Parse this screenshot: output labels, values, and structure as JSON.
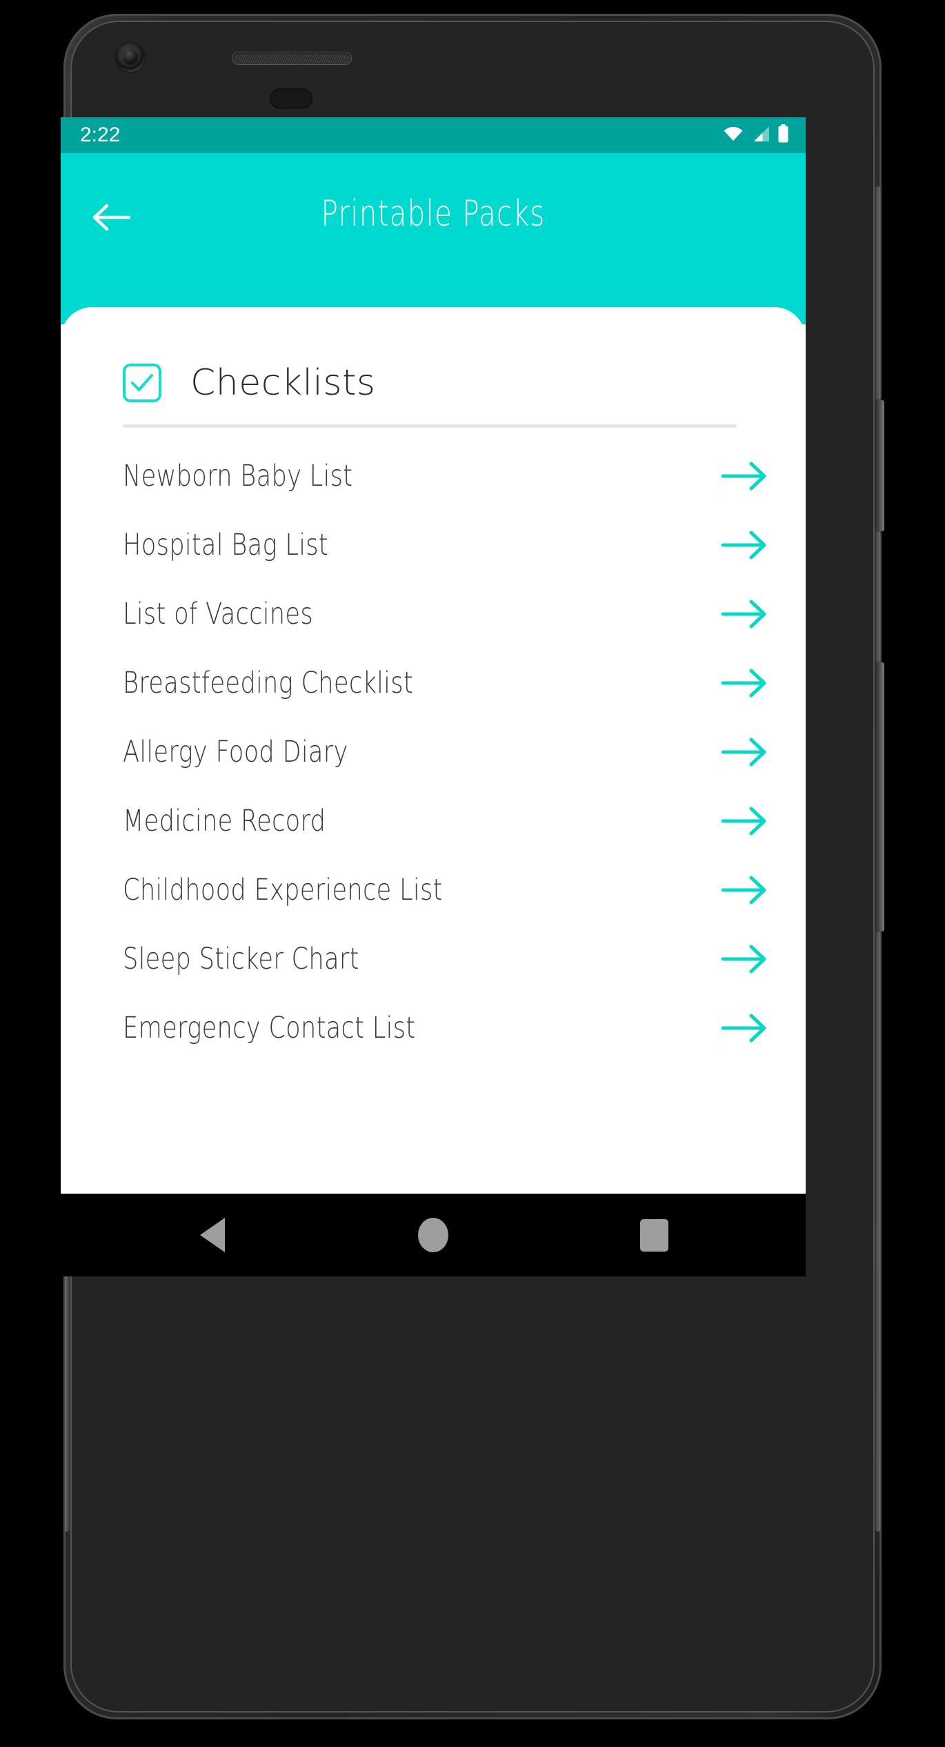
{
  "device": {
    "type": "android-phone",
    "frame_color": "#2a2a2a",
    "hardware": {
      "front_camera": "front-camera",
      "earpiece": "earpiece-speaker",
      "proximity_sensor": "proximity-sensor",
      "power_button": "power-button",
      "volume_rocker": "volume-rocker"
    }
  },
  "colors": {
    "status_bar": "#00a39c",
    "app_bar": "#00d9d0",
    "accent": "#14dccf",
    "arrow": "#0ad6c8",
    "card_background": "#ffffff",
    "text_primary": "#2b2b2b",
    "text_list": "#3b3b3b",
    "divider": "#e6e6e6",
    "nav_bar_background": "#000000",
    "nav_icon": "#9e9e9e"
  },
  "status_bar": {
    "time": "2:22",
    "icons": [
      "wifi-icon",
      "cellular-signal-icon",
      "battery-icon"
    ],
    "wifi_level": "full",
    "cellular_level": "partial",
    "battery_level": "full"
  },
  "app_bar": {
    "back_label": "back-arrow",
    "title": "Printable Packs"
  },
  "section": {
    "checkbox_state": "checked",
    "title": "Checklists"
  },
  "checklist_items": [
    {
      "label": "Newborn Baby List"
    },
    {
      "label": "Hospital Bag List"
    },
    {
      "label": "List of Vaccines"
    },
    {
      "label": "Breastfeeding Checklist"
    },
    {
      "label": "Allergy Food Diary"
    },
    {
      "label": "Medicine Record"
    },
    {
      "label": "Childhood Experience List"
    },
    {
      "label": "Sleep Sticker Chart"
    },
    {
      "label": "Emergency Contact List"
    }
  ],
  "nav_bar": {
    "back": "nav-back-button",
    "home": "nav-home-button",
    "recents": "nav-recents-button"
  }
}
